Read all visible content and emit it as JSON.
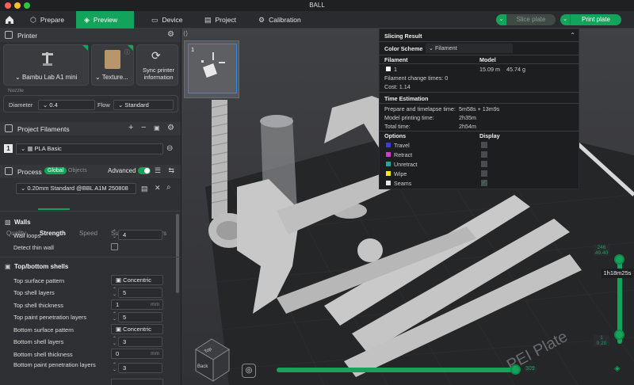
{
  "window": {
    "title": "BALL"
  },
  "toolbar": {
    "tabs": [
      {
        "label": "Prepare",
        "icon": "cube-icon"
      },
      {
        "label": "Preview",
        "icon": "layers-icon",
        "active": true
      },
      {
        "label": "Device",
        "icon": "monitor-icon"
      },
      {
        "label": "Project",
        "icon": "project-icon"
      },
      {
        "label": "Calibration",
        "icon": "calibration-icon"
      }
    ],
    "slice_label": "Slice plate",
    "print_label": "Print plate"
  },
  "printer": {
    "header": "Printer",
    "name": "Bambu Lab A1 mini",
    "plate": "Texture...",
    "sync": "Sync printer information",
    "nozzle_label": "Nozzle",
    "diameter_label": "Diameter",
    "diameter_value": "0.4",
    "flow_label": "Flow",
    "flow_value": "Standard"
  },
  "filaments": {
    "header": "Project Filaments",
    "index": "1",
    "name": "PLA Basic"
  },
  "process": {
    "header": "Process",
    "global": "Global",
    "objects": "Objects",
    "advanced": "Advanced",
    "profile": "0.20mm Standard @BBL A1M 250808",
    "tabs": [
      "Quality",
      "Strength",
      "Speed",
      "Support",
      "Others"
    ],
    "active_tab": "Strength"
  },
  "walls": {
    "header": "Walls",
    "loops_label": "Wall loops",
    "loops_value": "4",
    "thin_label": "Detect thin wall"
  },
  "topbottom": {
    "header": "Top/bottom shells",
    "rows": [
      {
        "label": "Top surface pattern",
        "value": "Concentric"
      },
      {
        "label": "Top shell layers",
        "value": "5"
      },
      {
        "label": "Top shell thickness",
        "value": "1",
        "unit": "mm"
      },
      {
        "label": "Top paint penetration layers",
        "value": "5"
      },
      {
        "label": "Bottom surface pattern",
        "value": "Concentric"
      },
      {
        "label": "Bottom shell layers",
        "value": "3"
      },
      {
        "label": "Bottom shell thickness",
        "value": "0",
        "unit": "mm"
      },
      {
        "label": "Bottom paint penetration layers",
        "value": "3"
      }
    ]
  },
  "slicing": {
    "title": "Slicing Result",
    "scheme_label": "Color Scheme",
    "scheme_value": "Filament",
    "col_filament": "Filament",
    "col_model": "Model",
    "fil_index": "1",
    "model_len": "15.09 m",
    "model_wt": "45.74 g",
    "change_times": "Filament change times:  0",
    "cost": "Cost:  1.14",
    "time_title": "Time Estimation",
    "prepare_label": "Prepare and timelapse time:",
    "prepare_value": "5m58s + 13m9s",
    "model_time_label": "Model printing time:",
    "model_time_value": "2h35m",
    "total_label": "Total time:",
    "total_value": "2h54m",
    "options_label": "Options",
    "display_label": "Display",
    "options": [
      {
        "label": "Travel",
        "color": "#3b3bd6"
      },
      {
        "label": "Retract",
        "color": "#c542c5"
      },
      {
        "label": "Unretract",
        "color": "#2aa1a1"
      },
      {
        "label": "Wipe",
        "color": "#f5e62a"
      },
      {
        "label": "Seams",
        "color": "#e8e8e8"
      }
    ]
  },
  "viewport": {
    "plate_number": "1",
    "layer_top_a": "246",
    "layer_top_b": "49.40",
    "time_tag": "1h18m25s",
    "layer_bottom_a": "1",
    "layer_bottom_b": "0.20",
    "progress_value": "309",
    "plate_text": "PEI Plate",
    "cube_top": "Top",
    "cube_front": "Back"
  },
  "colors": {
    "accent": "#13a35b"
  }
}
